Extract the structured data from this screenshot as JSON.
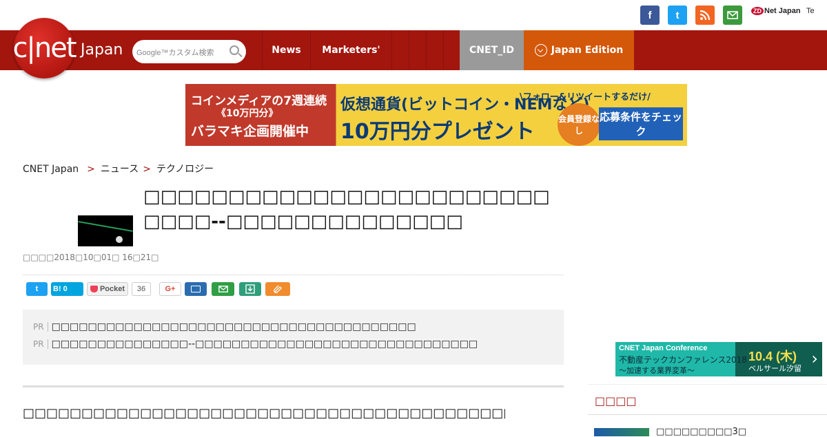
{
  "top_social": {
    "facebook": "f",
    "twitter": "t",
    "zd_badge": "ZD",
    "zd_text": "Net Japan",
    "te_text": "Te"
  },
  "brand": {
    "logo": "c|net",
    "sub": "Japan"
  },
  "search": {
    "placeholder": "Google™カスタム検索"
  },
  "nav": {
    "news": "News",
    "marketers": "Marketers'",
    "cnet_id": "CNET_ID",
    "edition": "Japan Edition"
  },
  "banner": {
    "line1": "コインメディアの7週連続",
    "line2": "《10万円分》",
    "line3": "バラマキ企画開催中",
    "main1": "仮想通貨(ビットコイン・NEMなど)",
    "main2": "10万円分プレゼント",
    "follow": "\\フォロー&リツイートするだけ/",
    "badge": "会員登録なし",
    "cta": "応募条件をチェック"
  },
  "breadcrumb": [
    "CNET Japan",
    "ニュース",
    "テクノロジー"
  ],
  "article": {
    "headline": "□□□□□□□□□□□□□□□□□□□□□□□□□□□□--□□□□□□□□□□□□□□",
    "date": "□□□□2018□10□01□ 16□21□"
  },
  "share": {
    "twitter": "t",
    "hatena": "B! 0",
    "pocket": "Pocket",
    "pocket_count": "36",
    "gplus": "G+"
  },
  "pr": {
    "tag": "PR",
    "items": [
      "□□□□□□□□□□□□□□□□□□□□□□□□□□□□□□□□□□□□□□□□",
      "□□□□□□□□□□□□□□□--□□□□□□□□□□□□□□□□□□□□□□□□□□□□□□□"
    ]
  },
  "lead": {
    "text": "□□□□□□□□□□□□□□□□□□□□□□□□□□□□□□□□□□□□□□□□□□□□□□□□□□□□□□□□□□□□",
    "link": "□□",
    "tail": "□□"
  },
  "sidebar": {
    "conference": {
      "title": "CNET Japan Conference",
      "name": "不動産テックカンファレンス2018",
      "sub": "〜加速する業界変革〜",
      "date": "10.4 (木)",
      "venue": "ベルサール汐留"
    },
    "section_title": "□□□□",
    "first_item": "□□□□□□□□□3□"
  }
}
